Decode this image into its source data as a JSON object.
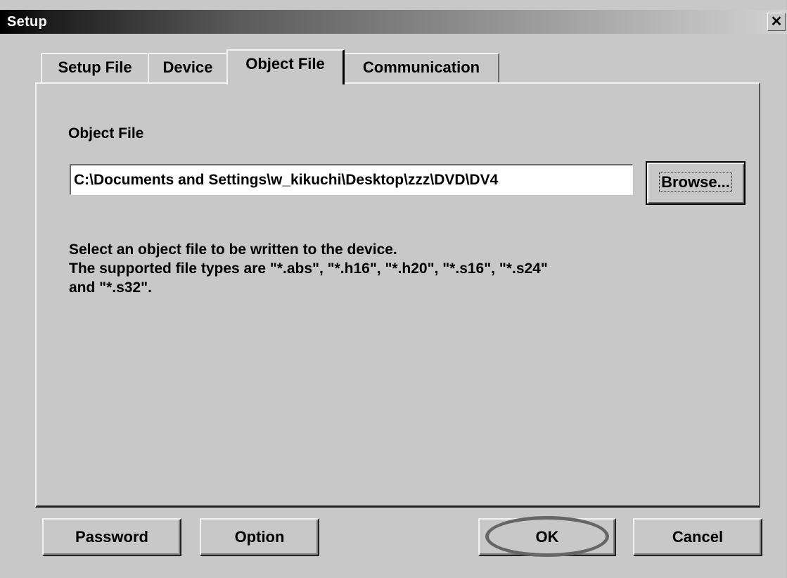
{
  "window": {
    "title": "Setup",
    "close_glyph": "✕"
  },
  "tabs": [
    {
      "label": "Setup File",
      "active": false
    },
    {
      "label": "Device",
      "active": false
    },
    {
      "label": "Object File",
      "active": true
    },
    {
      "label": "Communication",
      "active": false
    }
  ],
  "object_file": {
    "label": "Object File",
    "path_value": "C:\\Documents and Settings\\w_kikuchi\\Desktop\\zzz\\DVD\\DV4",
    "browse_label": "Browse...",
    "description": "Select an object file to be written to the device.\nThe supported file types are \"*.abs\", \"*.h16\", \"*.h20\", \"*.s16\", \"*.s24\"\nand \"*.s32\"."
  },
  "footer": {
    "password_label": "Password",
    "option_label": "Option",
    "ok_label": "OK",
    "cancel_label": "Cancel"
  },
  "colors": {
    "face": "#c8c8c8",
    "highlight_ring": "#666666"
  }
}
